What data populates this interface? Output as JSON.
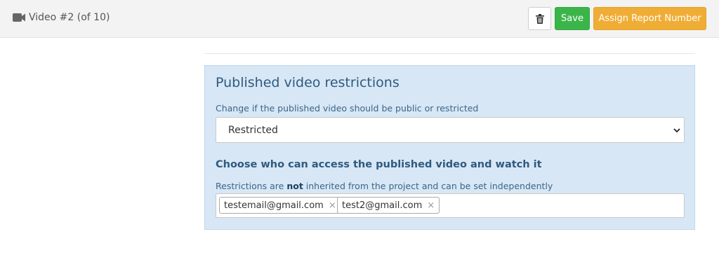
{
  "header": {
    "title": "Video #2 (of 10)",
    "icon": "video-camera-icon",
    "delete_icon": "trash-icon",
    "save_label": "Save",
    "assign_label": "Assign Report Number",
    "colors": {
      "save": "#3bb54a",
      "assign": "#f0ad35",
      "bar": "#f3f3f3"
    }
  },
  "restrictions": {
    "title": "Published video restrictions",
    "subtitle": "Change if the published video should be public or restricted",
    "select_value": "Restricted",
    "access_heading": "Choose who can access the published video and watch it",
    "note_before": "Restrictions are ",
    "note_bold": "not",
    "note_after": " inherited from the project and can be set independently",
    "emails": [
      "testemail@gmail.com",
      "test2@gmail.com"
    ],
    "remove_symbol": "×",
    "panel_color": "#d7e7f6"
  }
}
